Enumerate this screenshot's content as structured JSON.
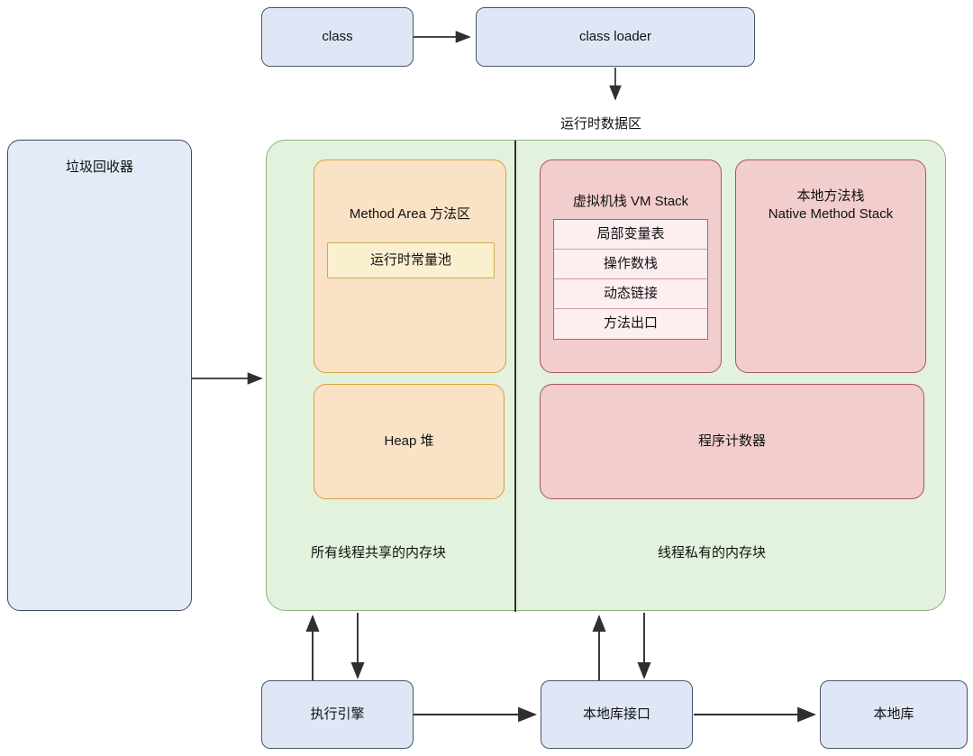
{
  "diagram": {
    "title_label": "运行时数据区",
    "nodes": {
      "class": "class",
      "class_loader": "class loader",
      "garbage_collector": "垃圾回收器",
      "method_area": "Method Area 方法区",
      "runtime_constant_pool": "运行时常量池",
      "heap": "Heap 堆",
      "vm_stack": "虚拟机栈 VM Stack",
      "native_method_stack_line1": "本地方法栈",
      "native_method_stack_line2": "Native Method Stack",
      "program_counter": "程序计数器",
      "shared_memory_label": "所有线程共享的内存块",
      "private_memory_label": "线程私有的内存块",
      "execution_engine": "执行引擎",
      "native_interface": "本地库接口",
      "native_library": "本地库"
    },
    "vm_stack_frames": [
      "局部变量表",
      "操作数栈",
      "动态链接",
      "方法出口"
    ],
    "colors": {
      "blue_fill": "#dfe7f7",
      "blue_stroke": "#4a5568",
      "green_fill": "#e3f2dc",
      "green_stroke": "#8bb07a",
      "orange_fill": "#fae2c6",
      "orange_stroke": "#d4a03c",
      "pool_fill": "#faf0cf",
      "pool_stroke": "#c9aa54",
      "red_fill": "#f2cdcd",
      "red_stroke": "#a8545c",
      "frame_fill": "#fdeef0",
      "arrow": "#2f2f2f"
    }
  }
}
